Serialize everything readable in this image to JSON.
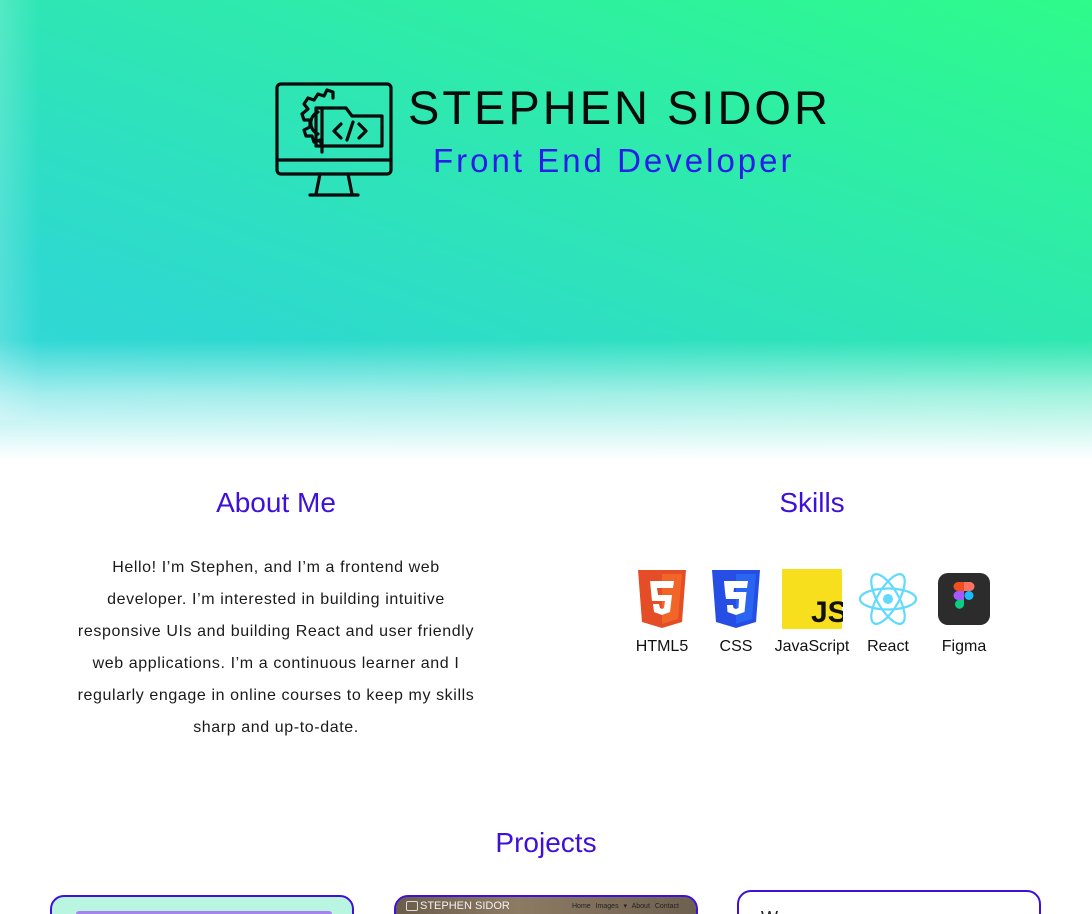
{
  "header": {
    "name": "STEPHEN SIDOR",
    "role": "Front End Developer",
    "logo_icon": "computer-code-gear-icon"
  },
  "about": {
    "title": "About Me",
    "text": "Hello! I’m Stephen, and I’m a frontend web developer. I’m interested in building intuitive responsive UIs and building React and user friendly web applications. I’m a continuous learner and I regularly engage in online courses to keep my skills sharp and up-to-date."
  },
  "skills": {
    "title": "Skills",
    "items": [
      {
        "label": "HTML5",
        "icon": "html5-icon"
      },
      {
        "label": "CSS",
        "icon": "css3-icon"
      },
      {
        "label": "JavaScript",
        "icon": "javascript-icon"
      },
      {
        "label": "React",
        "icon": "react-icon"
      },
      {
        "label": "Figma",
        "icon": "figma-icon"
      }
    ]
  },
  "projects": {
    "title": "Projects",
    "cards": [
      {
        "thumbnail": "project-thumbnail-1"
      },
      {
        "thumbnail": "project-thumbnail-2",
        "brand": "STEPHEN SIDOR",
        "nav": "Home Images ▾ About Contact"
      },
      {
        "thumbnail": "project-thumbnail-3",
        "glyph": "W"
      }
    ]
  },
  "colors": {
    "accent": "#3f10d8",
    "role": "#2a1ee6",
    "hero_start": "#2efb8a",
    "hero_end": "#36d6dd"
  }
}
